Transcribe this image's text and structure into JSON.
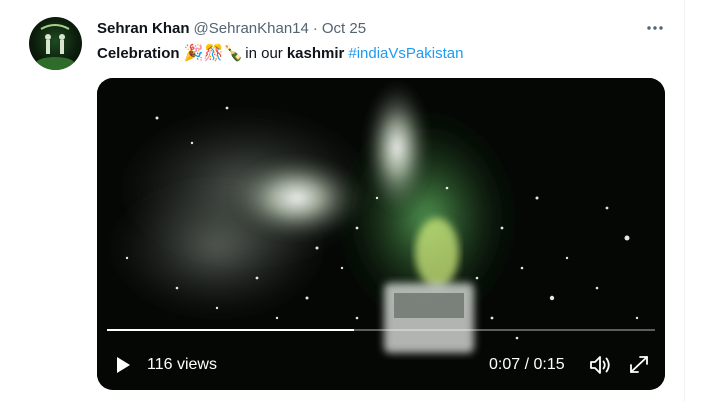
{
  "tweet": {
    "author_name": "Sehran Khan",
    "author_handle": "@SehranKhan14",
    "separator": "·",
    "date": "Oct 25",
    "text_bold_1": "Celebration",
    "emojis": "🎉🎊🍾",
    "text_plain_1": "in our",
    "text_bold_2": "kashmir",
    "hashtag": "#indiaVsPakistan",
    "more_icon": "more-horizontal-icon"
  },
  "video": {
    "views": "116 views",
    "time": "0:07 / 0:15",
    "progress": 0.45,
    "play_icon": "play-icon",
    "volume_icon": "volume-icon",
    "fullscreen_icon": "fullscreen-icon"
  },
  "colors": {
    "text": "#0f1419",
    "secondary": "#536471",
    "link": "#1d9bf0"
  }
}
